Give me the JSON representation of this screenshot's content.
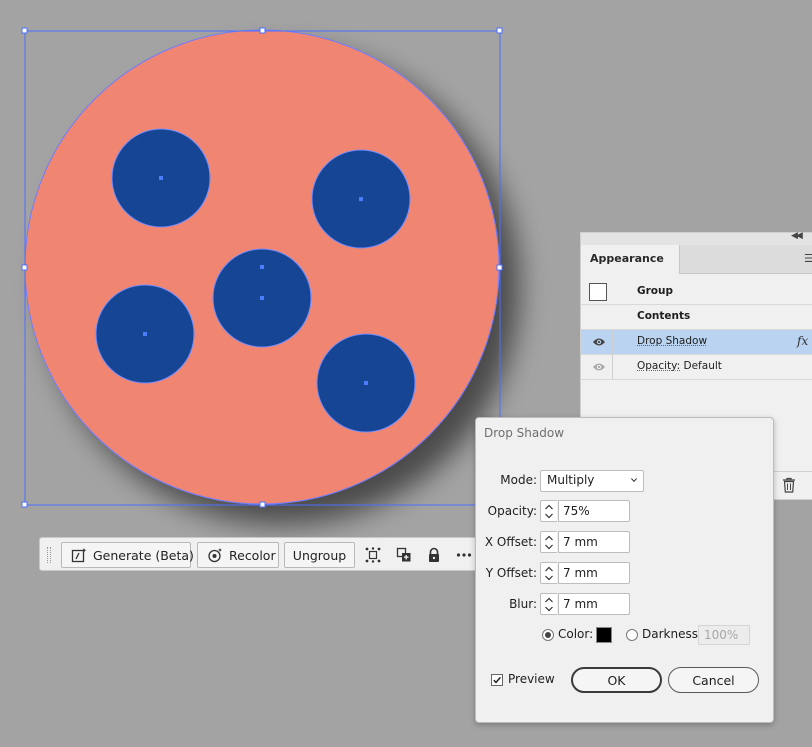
{
  "canvas": {
    "colors": {
      "background": "#a3a3a3",
      "large_circle": "#f08672",
      "small_circles": "#134494",
      "selection": "#4d6fff"
    }
  },
  "taskbar": {
    "generate_label": "Generate (Beta)",
    "recolor_label": "Recolor",
    "ungroup_label": "Ungroup",
    "icons": [
      "isolate-icon",
      "arrange-icon",
      "lock-icon",
      "more-icon"
    ]
  },
  "appearance": {
    "tab_label": "Appearance",
    "rows": {
      "group": "Group",
      "contents": "Contents",
      "effect": "Drop Shadow",
      "fx": "fx",
      "opacity_label": "Opacity:",
      "opacity_value": "Default"
    }
  },
  "dialog": {
    "title": "Drop Shadow",
    "mode_label": "Mode:",
    "mode_value": "Multiply",
    "opacity_label": "Opacity:",
    "opacity_value": "75%",
    "xoffset_label": "X Offset:",
    "xoffset_value": "7 mm",
    "yoffset_label": "Y Offset:",
    "yoffset_value": "7 mm",
    "blur_label": "Blur:",
    "blur_value": "7 mm",
    "color_label": "Color:",
    "darkness_label": "Darkness:",
    "darkness_value": "100%",
    "preview_label": "Preview",
    "ok_label": "OK",
    "cancel_label": "Cancel",
    "shadow_color": "#000000"
  }
}
